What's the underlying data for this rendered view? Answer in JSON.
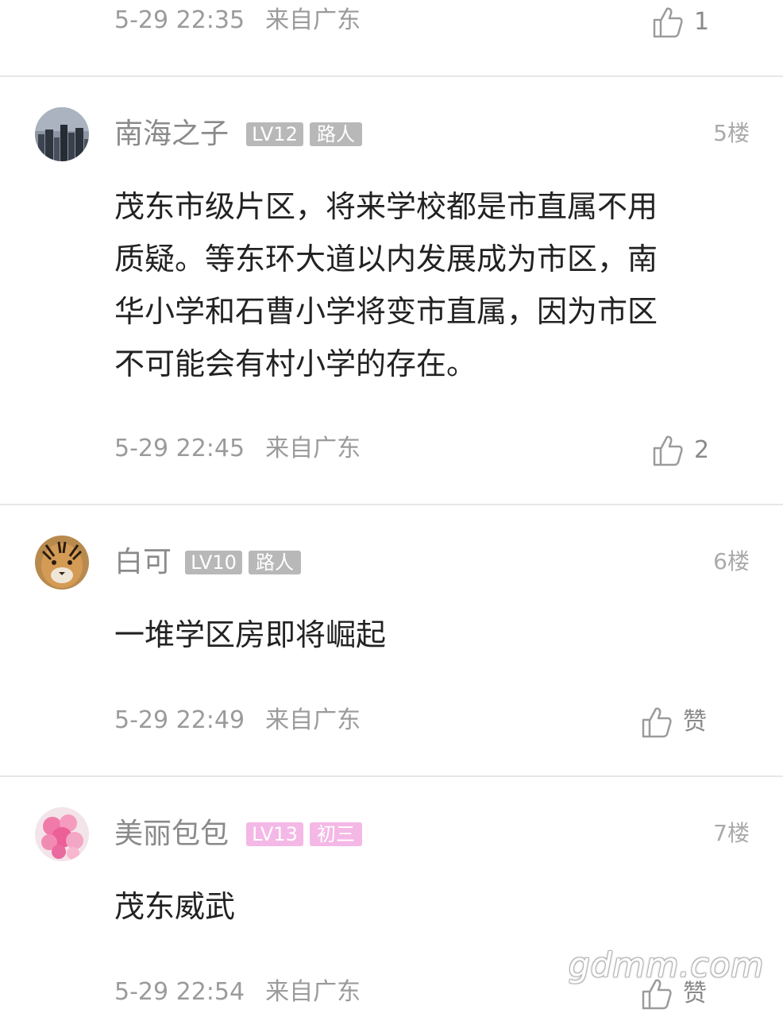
{
  "comments": [
    {
      "time": "5-29 22:35",
      "location": "来自广东",
      "likes": "1"
    },
    {
      "username": "南海之子",
      "level": "LV12",
      "rank": "路人",
      "floor": "5楼",
      "content_lines": [
        "茂东市级片区，将来学校都是市直属不用",
        "质疑。等东环大道以内发展成为市区，南",
        "华小学和石曹小学将变市直属，因为市区",
        "不可能会有村小学的存在。"
      ],
      "time": "5-29 22:45",
      "location": "来自广东",
      "likes": "2",
      "avatar_icon": "city-skyline-avatar"
    },
    {
      "username": "白可",
      "level": "LV10",
      "rank": "路人",
      "floor": "6楼",
      "content_lines": [
        "一堆学区房即将崛起"
      ],
      "time": "5-29 22:49",
      "location": "来自广东",
      "likes": "赞",
      "avatar_icon": "tiger-avatar"
    },
    {
      "username": "美丽包包",
      "level": "LV13",
      "rank": "初三",
      "floor": "7楼",
      "content_lines": [
        "茂东威武"
      ],
      "time": "5-29 22:54",
      "location": "来自广东",
      "likes": "赞",
      "avatar_icon": "pink-flower-avatar"
    }
  ],
  "watermark": "gdmm.com",
  "colors": {
    "badge_gray": "#b8b8b8",
    "badge_pink": "#f4b8e6",
    "meta_text": "#9b9b9b",
    "body_text": "#222222",
    "divider": "#e7e7e7"
  }
}
